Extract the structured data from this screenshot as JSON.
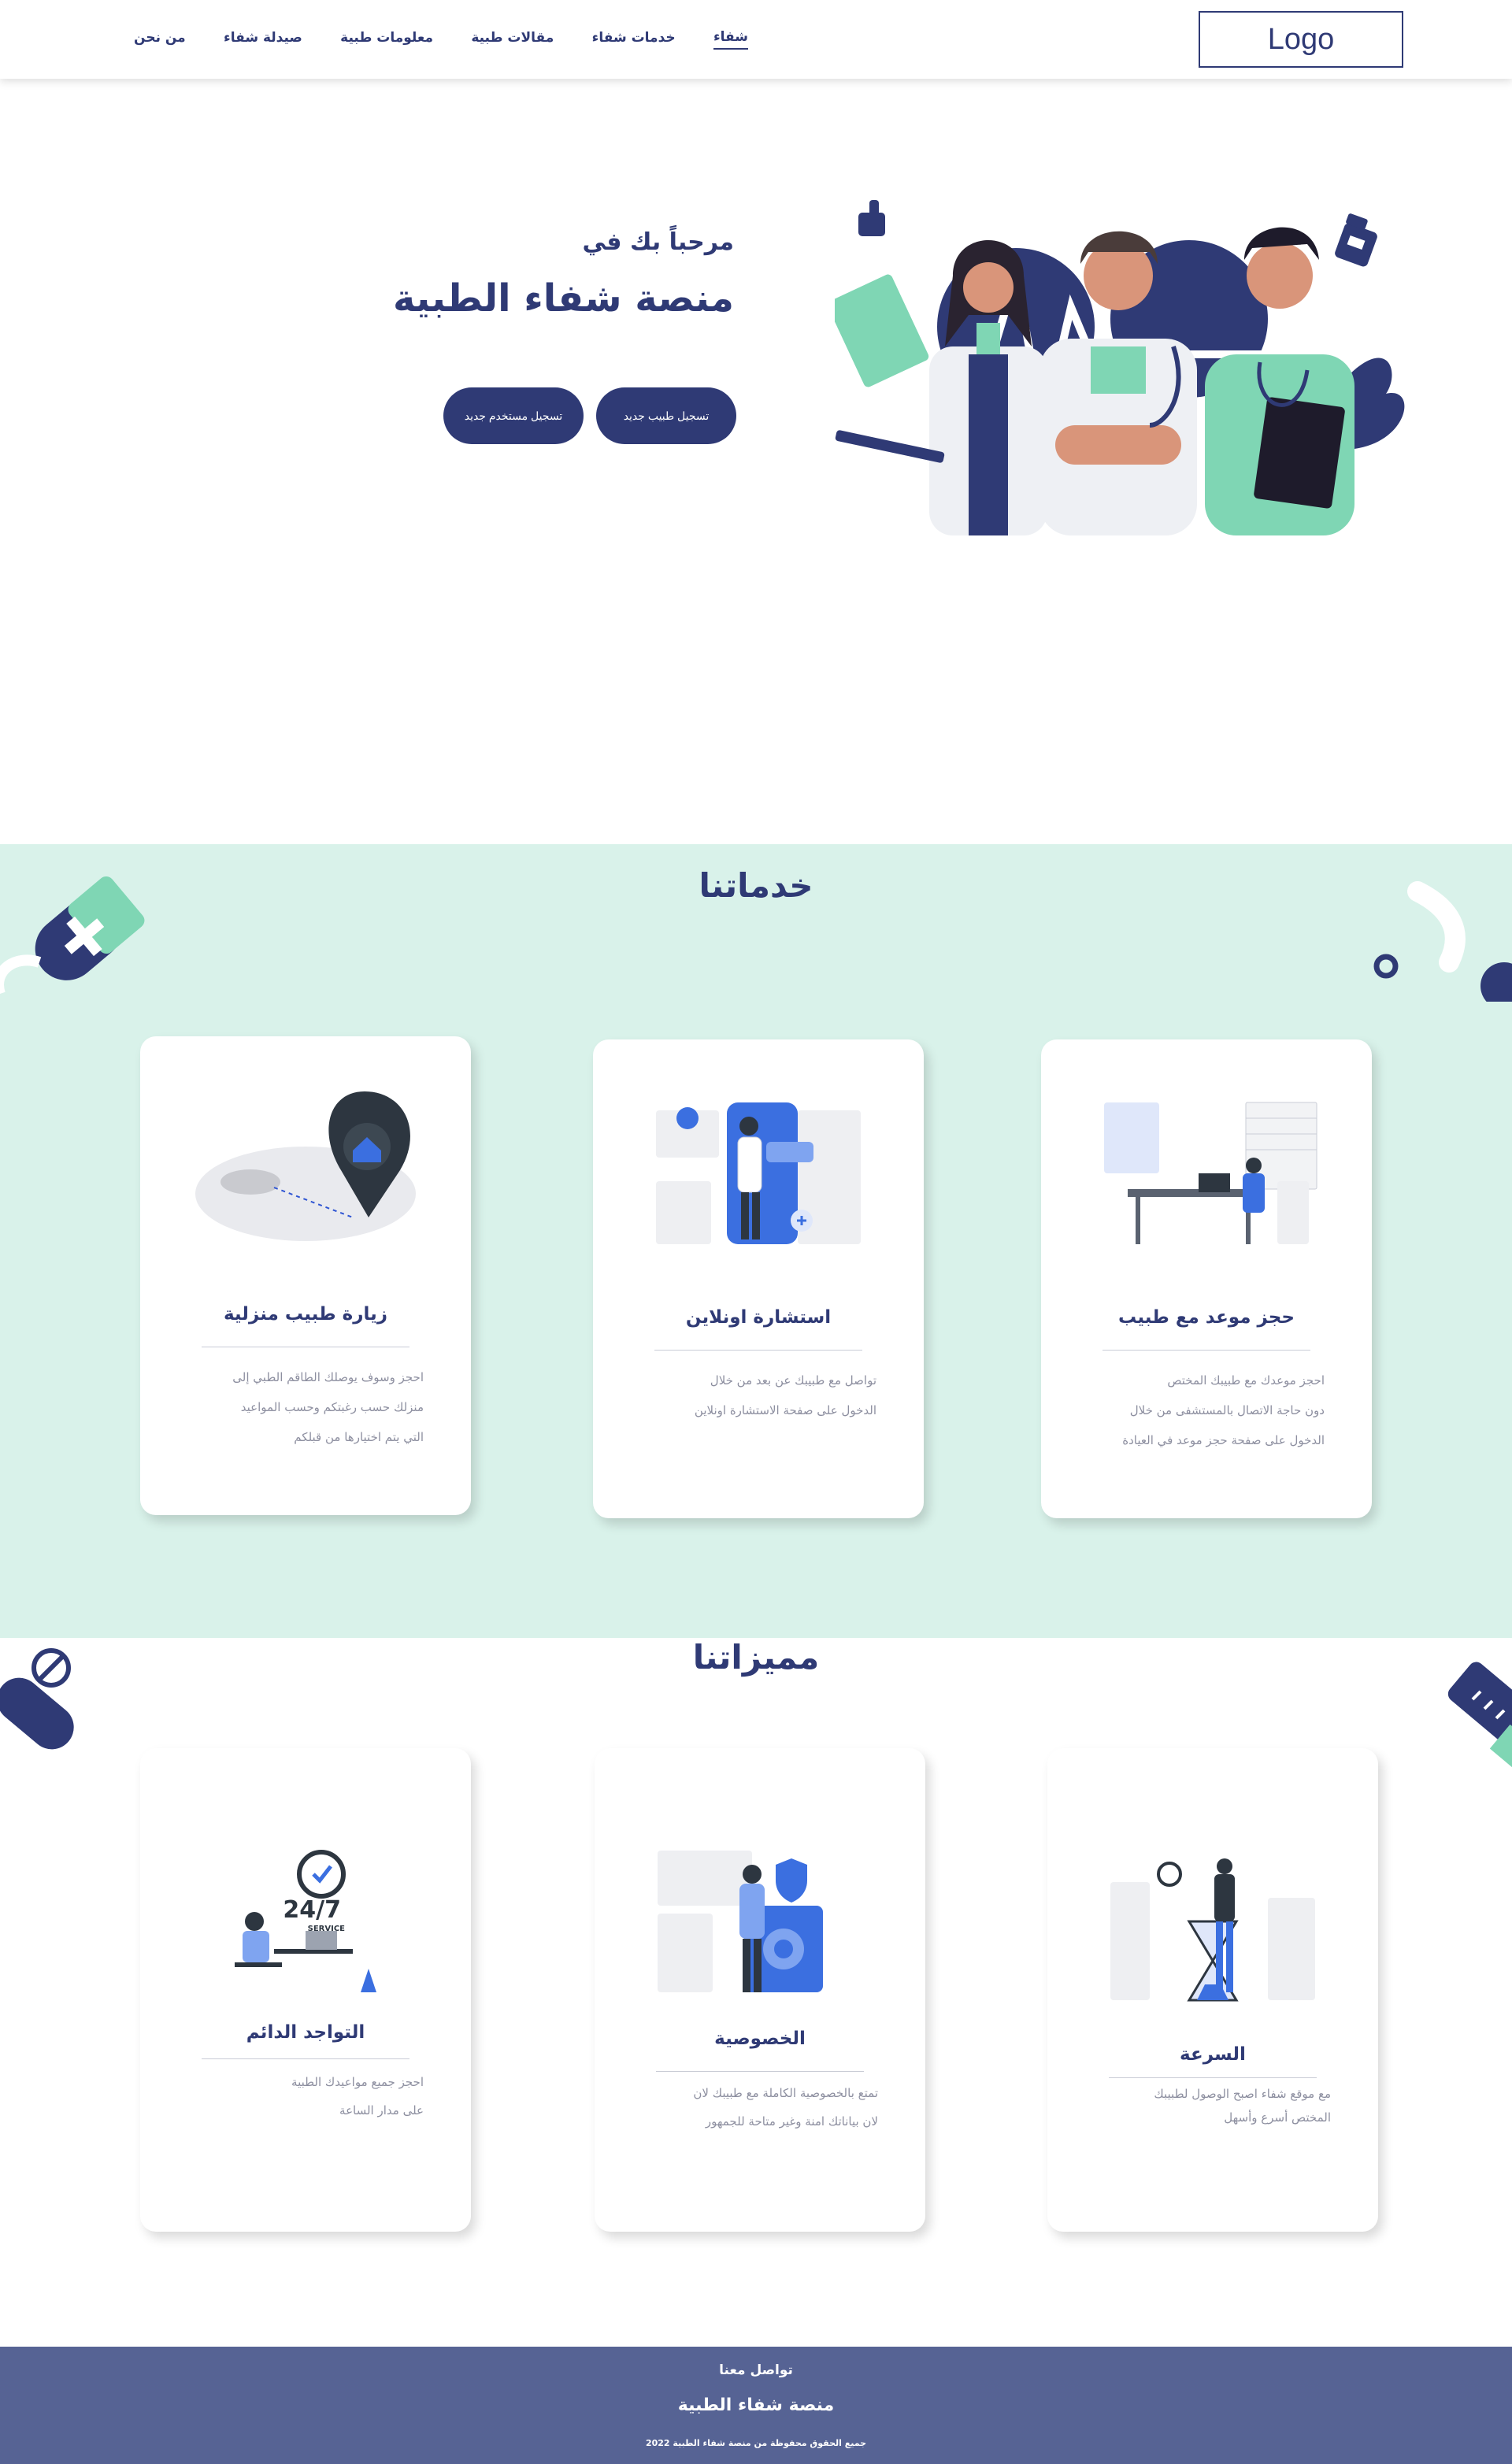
{
  "nav": {
    "logo": "Logo",
    "links": [
      "شفاء",
      "خدمات شفاء",
      "مقالات طبية",
      "معلومات طبية",
      "صيدلة شفاء",
      "من نحن"
    ],
    "active_index": 0
  },
  "hero": {
    "subtitle": "مرحباً بك في",
    "title": "منصة شفاء الطبية",
    "btn_user": "تسجيل مستخدم جديد",
    "btn_doctor": "تسجيل طبيب جديد"
  },
  "services": {
    "title": "خدماتنا",
    "cards": [
      {
        "title": "حجز موعد مع طبيب",
        "lines": [
          "احجز موعدك مع طبيبك المختص",
          "دون حاجة الاتصال بالمستشفى من خلال",
          "الدخول على صفحة حجز موعد في العيادة"
        ]
      },
      {
        "title": "استشارة اونلاين",
        "lines": [
          "تواصل مع طبيبك عن بعد من خلال",
          "الدخول على صفحة الاستشارة اونلاين"
        ]
      },
      {
        "title": "زيارة طبيب منزلية",
        "lines": [
          "احجز وسوف يوصلك الطاقم الطبي إلى",
          "منزلك حسب رغبتكم وحسب المواعيد",
          "التي يتم اختيارها من قبلكم"
        ]
      }
    ]
  },
  "features": {
    "title": "مميزاتنا",
    "cards": [
      {
        "title": "السرعة",
        "lines": [
          "مع موقع شفاء اصبح الوصول لطبيبك",
          "المختص أسرع وأسهل"
        ]
      },
      {
        "title": "الخصوصية",
        "lines": [
          "تمتع بالخصوصية الكاملة مع طبيبك لان",
          "لان بياناتك امنة وغير متاحة للجمهور"
        ]
      },
      {
        "title": "التواجد الدائم",
        "lines": [
          "احجز جميع مواعيدك الطبية",
          "على مدار الساعة"
        ]
      }
    ],
    "badge": "24/7",
    "badge_sub": "SERVICE"
  },
  "footer": {
    "contact": "تواصل معنا",
    "name": "منصة شفاء الطبية",
    "copyright": "جميع الحقوق محفوظة من منصة شفاء الطبية 2022"
  },
  "colors": {
    "primary": "#2f3a75",
    "mint": "#d9f2ea",
    "footer": "#566394",
    "accent_green": "#7fd6b4"
  }
}
